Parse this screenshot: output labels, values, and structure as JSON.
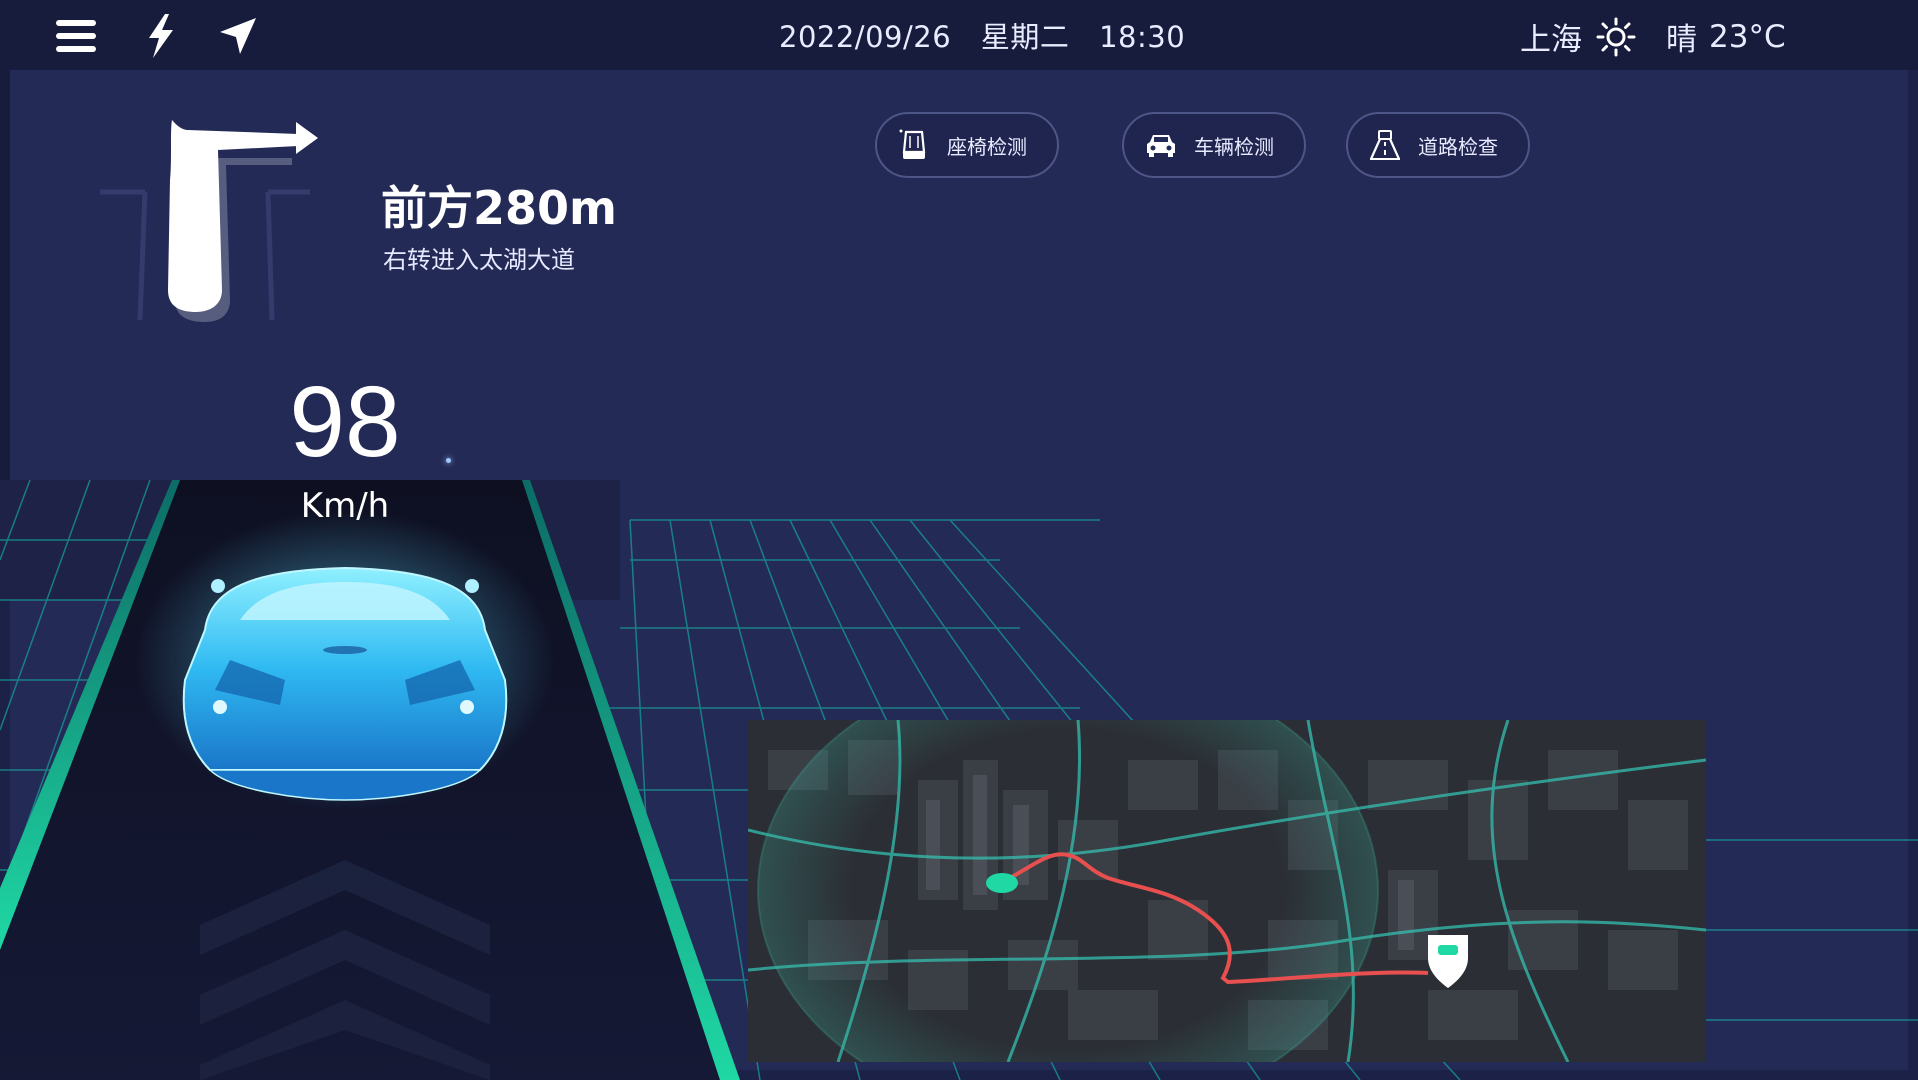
{
  "topbar": {
    "menu_icon": "menu-icon",
    "power_icon": "lightning-icon",
    "nav_icon": "navigation-arrow-icon",
    "date": "2022/09/26",
    "weekday": "星期二",
    "time": "18:30",
    "city": "上海",
    "weather_icon": "sun-icon",
    "weather": "晴",
    "temperature": "23°C"
  },
  "navigation": {
    "turn_icon": "turn-right-arrow-icon",
    "distance": "前方280m",
    "instruction": "右转进入太湖大道"
  },
  "speed": {
    "value": "98",
    "unit": "Km/h"
  },
  "actions": [
    {
      "label": "座椅检测",
      "icon": "seat-icon"
    },
    {
      "label": "车辆检测",
      "icon": "car-icon"
    },
    {
      "label": "道路检查",
      "icon": "road-icon"
    }
  ],
  "map": {
    "start_marker_color": "#1fd8a4",
    "route_color": "#e8504f",
    "destination_icon": "destination-pin-icon"
  },
  "colors": {
    "accent": "#1fd8a4",
    "grid": "#1aa6a0",
    "car": "#36c7ff",
    "panel": "#242a56",
    "topbar": "#171b3c"
  }
}
